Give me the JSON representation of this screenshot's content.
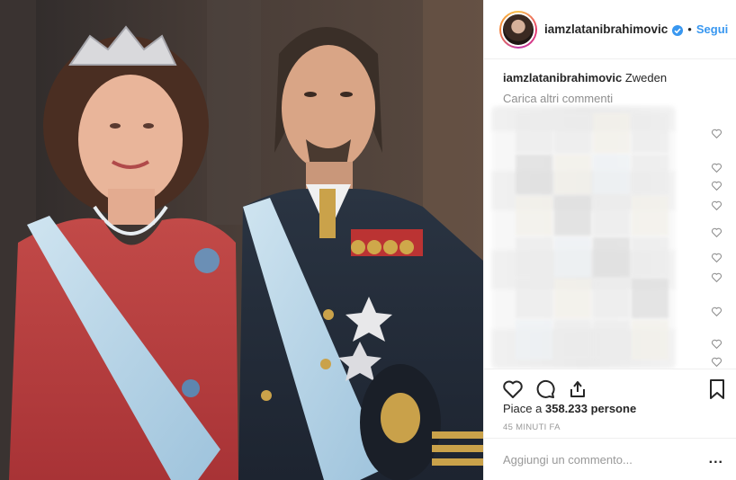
{
  "post": {
    "username": "iamzlatanibrahimovic",
    "verified_icon": "verified-badge-icon",
    "separator": "•",
    "follow_label": "Segui"
  },
  "caption": {
    "username": "iamzlatanibrahimovic",
    "text": "Zweden"
  },
  "comments": {
    "load_more_label": "Carica altri commenti",
    "blurred_comment_count": 11,
    "like_icon": "heart-outline-icon"
  },
  "actions": {
    "like_icon": "heart-icon",
    "comment_icon": "comment-icon",
    "share_icon": "share-icon",
    "save_icon": "bookmark-icon"
  },
  "likes": {
    "prefix": "Piace a ",
    "count": "358.233",
    "suffix": " persone"
  },
  "timestamp": "45 MINUTI FA",
  "add_comment": {
    "placeholder": "Aggiungi un commento...",
    "more_label": "..."
  },
  "colors": {
    "accent": "#3897f0",
    "muted": "#8e8e8e",
    "text": "#262626"
  }
}
